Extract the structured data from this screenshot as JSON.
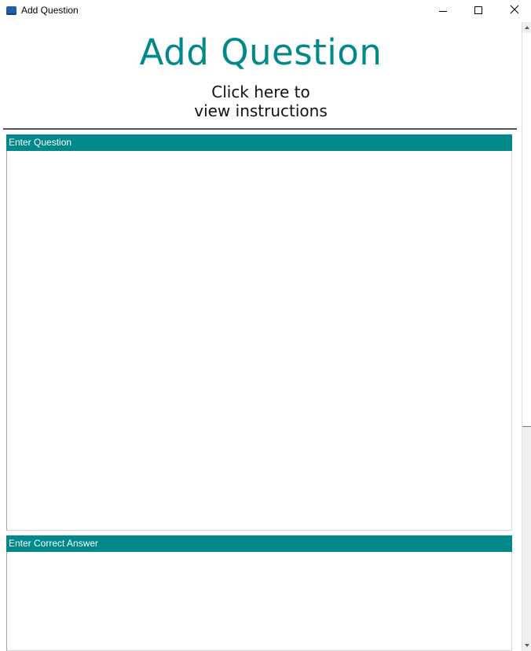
{
  "window": {
    "title": "Add Question",
    "icon": "app-window-icon",
    "controls": [
      "minimize-icon",
      "maximize-icon",
      "close-icon"
    ]
  },
  "header": {
    "title": "Add Question",
    "instructions_line1": "Click here to",
    "instructions_line2": "view instructions"
  },
  "question": {
    "label": "Enter Question",
    "value": ""
  },
  "answer": {
    "label": "Enter Correct Answer",
    "value": ""
  },
  "colors": {
    "accent": "#00888a",
    "divider": "#555555"
  }
}
